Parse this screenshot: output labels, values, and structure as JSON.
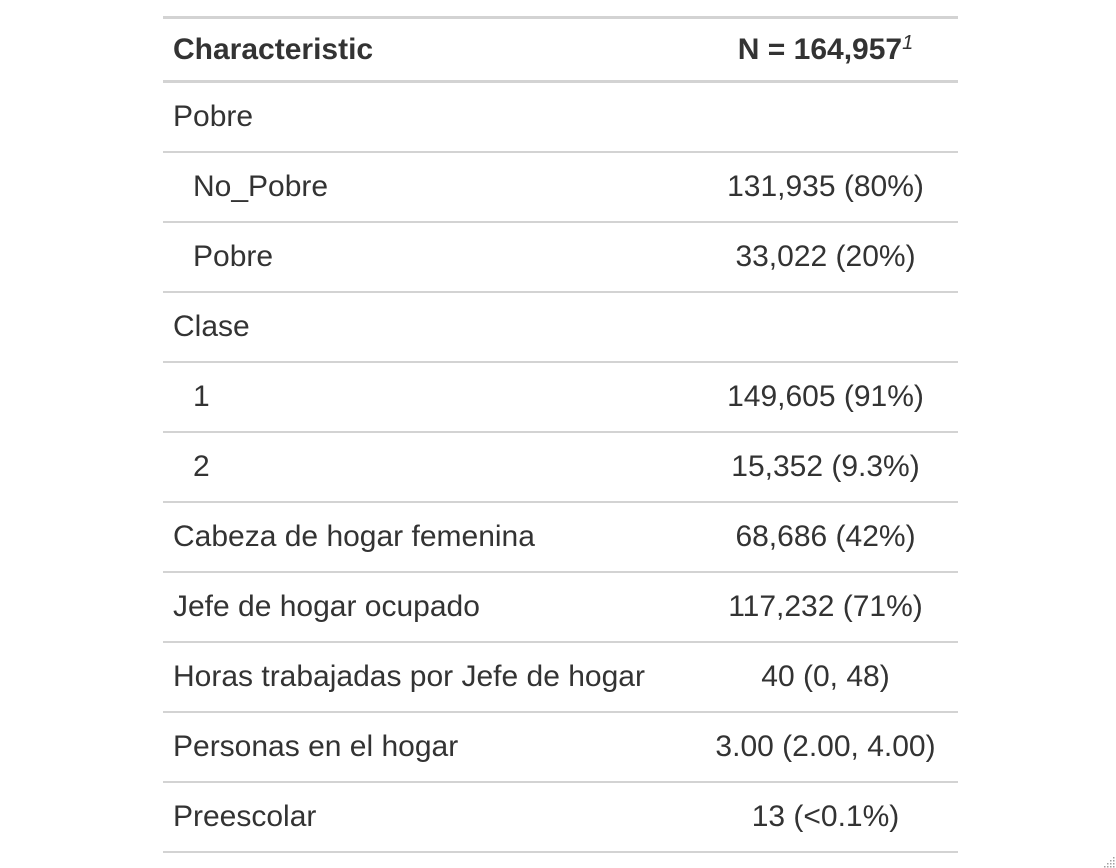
{
  "table": {
    "header": {
      "characteristic": "Characteristic",
      "n_label": "N = 164,957",
      "footnote_mark": "1"
    },
    "rows": [
      {
        "label": "Pobre",
        "value": "",
        "indent": false
      },
      {
        "label": "No_Pobre",
        "value": "131,935 (80%)",
        "indent": true
      },
      {
        "label": "Pobre",
        "value": "33,022 (20%)",
        "indent": true
      },
      {
        "label": "Clase",
        "value": "",
        "indent": false
      },
      {
        "label": "1",
        "value": "149,605 (91%)",
        "indent": true
      },
      {
        "label": "2",
        "value": "15,352 (9.3%)",
        "indent": true
      },
      {
        "label": "Cabeza de hogar femenina",
        "value": "68,686 (42%)",
        "indent": false
      },
      {
        "label": "Jefe de hogar ocupado",
        "value": "117,232 (71%)",
        "indent": false
      },
      {
        "label": "Horas trabajadas por Jefe de hogar",
        "value": "40 (0, 48)",
        "indent": false
      },
      {
        "label": "Personas en el hogar",
        "value": "3.00 (2.00, 4.00)",
        "indent": false
      },
      {
        "label": "Preescolar",
        "value": "13 (<0.1%)",
        "indent": false
      }
    ]
  },
  "colors": {
    "text": "#333333",
    "rule": "#d3d3d3",
    "background": "#ffffff"
  }
}
